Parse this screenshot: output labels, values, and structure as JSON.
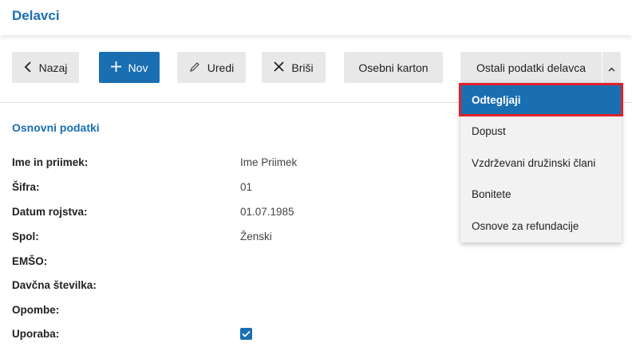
{
  "header": {
    "title": "Delavci"
  },
  "toolbar": {
    "back_label": "Nazaj",
    "new_label": "Nov",
    "edit_label": "Uredi",
    "delete_label": "Briši",
    "personal_card_label": "Osebni karton",
    "other_data_label": "Ostali podatki delavca"
  },
  "dropdown": {
    "items": [
      {
        "label": "Odtegljaji",
        "selected": true
      },
      {
        "label": "Dopust"
      },
      {
        "label": "Vzdrževani družinski člani"
      },
      {
        "label": "Bonitete"
      },
      {
        "label": "Osnove za refundacije"
      }
    ]
  },
  "section": {
    "title": "Osnovni podatki",
    "rows": [
      {
        "label": "Ime in priimek:",
        "value": "Ime Priimek"
      },
      {
        "label": "Šifra:",
        "value": "01"
      },
      {
        "label": "Datum rojstva:",
        "value": "01.07.1985"
      },
      {
        "label": "Spol:",
        "value": "Ženski"
      },
      {
        "label": "EMŠO:",
        "value": ""
      },
      {
        "label": "Davčna številka:",
        "value": ""
      },
      {
        "label": "Opombe:",
        "value": ""
      },
      {
        "label": "Uporaba:",
        "checked": true
      }
    ]
  },
  "colors": {
    "accent": "#1a6fb3",
    "highlight_border": "#e0202a",
    "button_bg": "#e8e8e8"
  }
}
